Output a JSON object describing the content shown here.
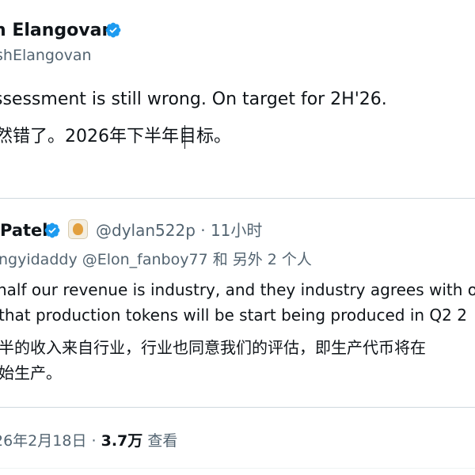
{
  "tweet": {
    "author_name": "h Elangovan",
    "author_handle": "shElangovan",
    "text_line_1": "ssessment is still wrong. On target for 2H'26.",
    "text_line_2": "然错了。2026年下半年目标。",
    "timestamp": "26年2月18日",
    "separator": "·",
    "views_count": "3.7万",
    "views_label": "查看"
  },
  "quoted_tweet": {
    "author_name": "Patel",
    "handle_time": "@dylan522p · 11小时",
    "reply_context": "ngyidaddy @Elon_fanboy77 和 另外 2 个人",
    "text_line_1": "half our revenue is industry, and they industry agrees with o",
    "text_line_2": " that production tokens will be start being produced in Q2 2",
    "text_line_3": "半的收入来自行业，行业也同意我们的评估，即生产代币将在",
    "text_line_4": "始生产。"
  },
  "colors": {
    "verified_blue": "#1d9bf0",
    "text_primary": "#0f1419",
    "text_secondary": "#536471",
    "border": "#cfd9de"
  },
  "icons": {
    "verified": "verified-badge-icon",
    "affiliate": "affiliate-badge-icon"
  }
}
